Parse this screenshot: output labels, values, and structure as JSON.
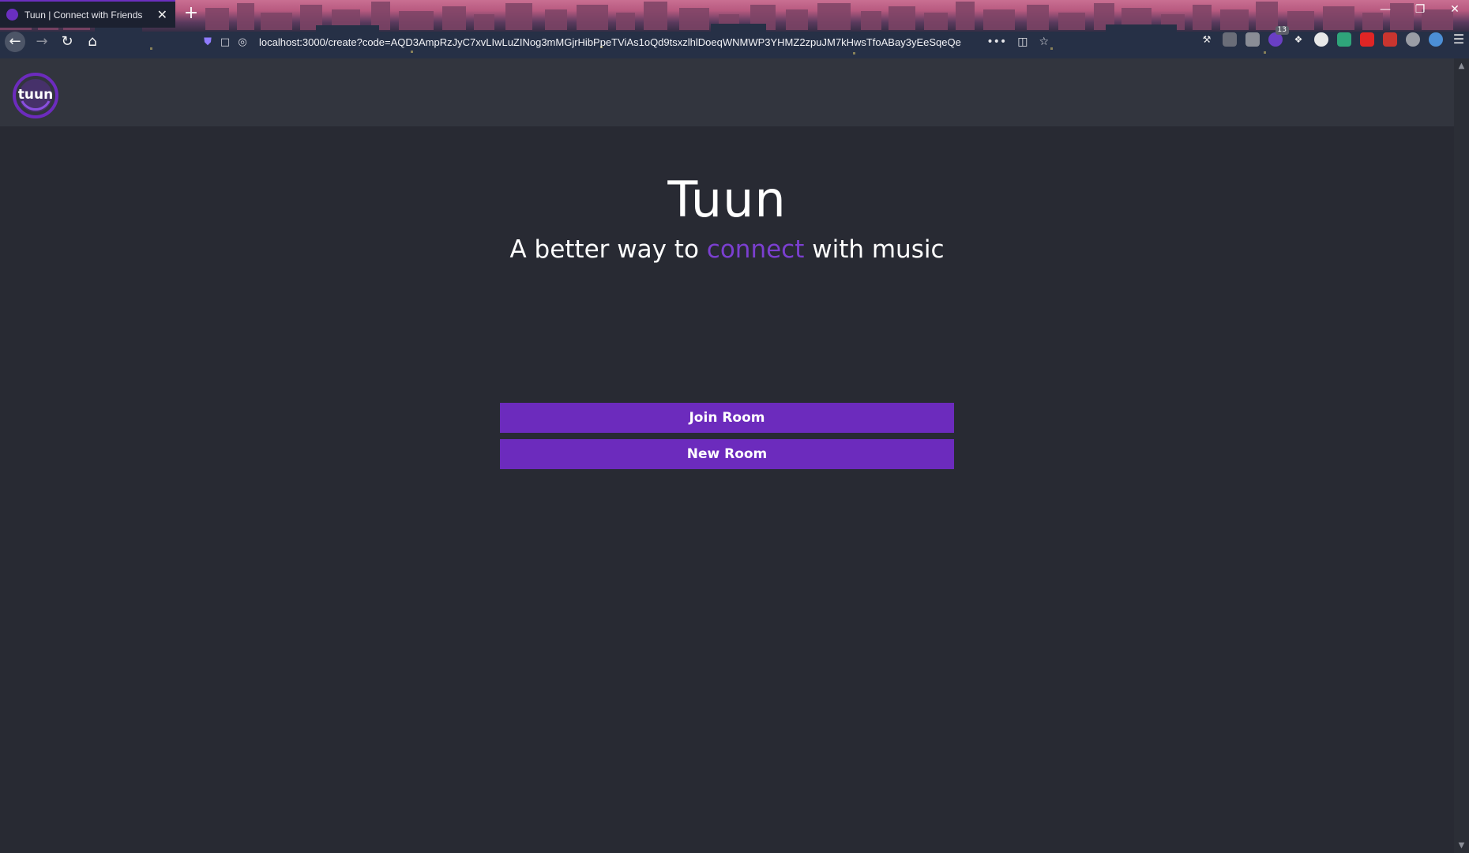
{
  "browser": {
    "tab_title": "Tuun | Connect with Friends",
    "tab_close": "✕",
    "new_tab": "+",
    "url": "localhost:3000/create?code=AQD3AmpRzJyC7xvLIwLuZINog3mMGjrHibPpeTViAs1oQd9tsxzlhlDoeqWNMWP3YHMZ2zpuJM7kHwsTfoABay3yEeSqeQe",
    "window_controls": {
      "minimize": "—",
      "restore": "❐",
      "close": "✕"
    },
    "nav_icons": {
      "back": "←",
      "forward": "→",
      "reload": "↻",
      "home": "⌂"
    },
    "url_actions": {
      "more": "•••",
      "pocket": "◫",
      "bookmark": "☆"
    },
    "extension_badge": "13",
    "menu": "☰"
  },
  "app": {
    "logo_text": "tuun",
    "title": "Tuun",
    "subtitle_before": "A better way to ",
    "subtitle_accent": "connect",
    "subtitle_after": " with music",
    "join_button": "Join Room",
    "new_button": "New Room"
  },
  "colors": {
    "page_background": "#282a33",
    "header_background": "#32353e",
    "accent": "#7b3fd0",
    "button": "#6c2bbd"
  }
}
